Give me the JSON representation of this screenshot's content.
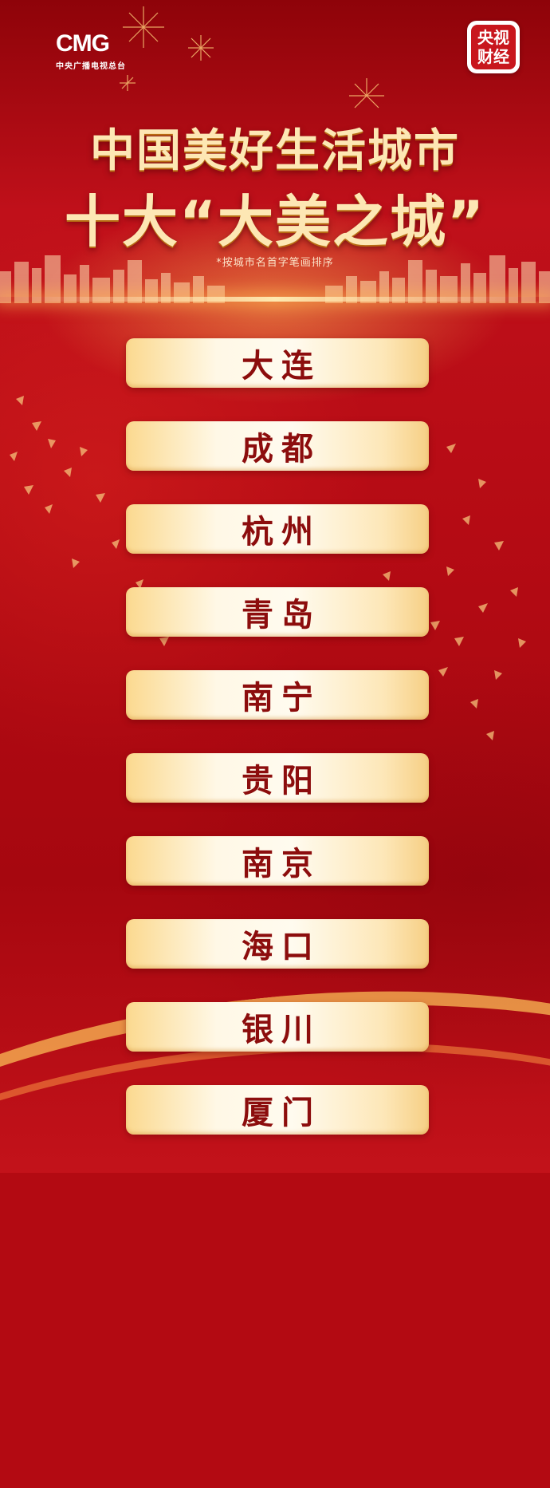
{
  "brand": {
    "cmg_mark": "CMG",
    "cmg_sub": "中央广播电视总台",
    "badge_line1": "央视",
    "badge_line2": "财经"
  },
  "title": {
    "line1": "中国美好生活城市",
    "line2": "十大“大美之城”",
    "note": "*按城市名首字笔画排序"
  },
  "cities": [
    "大连",
    "成都",
    "杭州",
    "青岛",
    "南宁",
    "贵阳",
    "南京",
    "海口",
    "银川",
    "厦门"
  ],
  "colors": {
    "background_red": "#b30a12",
    "title_gold": "#fde7b4",
    "card_cream": "#fff8e6",
    "city_text": "#8c0d0d"
  }
}
